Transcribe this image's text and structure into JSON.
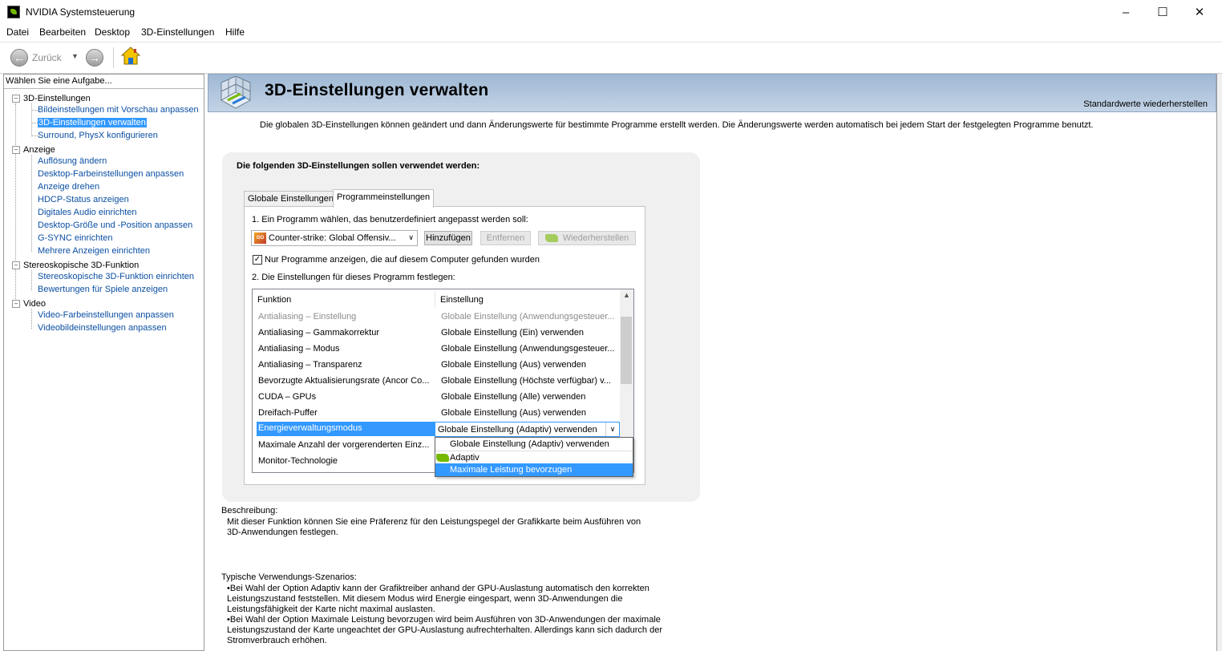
{
  "window": {
    "title": "NVIDIA Systemsteuerung"
  },
  "menu": [
    "Datei",
    "Bearbeiten",
    "Desktop",
    "3D-Einstellungen",
    "Hilfe"
  ],
  "toolbar": {
    "back_label": "Zurück"
  },
  "sidebar": {
    "header": "Wählen Sie eine Aufgabe...",
    "categories": [
      {
        "label": "3D-Einstellungen",
        "items": [
          "Bildeinstellungen mit Vorschau anpassen",
          "3D-Einstellungen verwalten",
          "Surround, PhysX konfigurieren"
        ]
      },
      {
        "label": "Anzeige",
        "items": [
          "Auflösung ändern",
          "Desktop-Farbeinstellungen anpassen",
          "Anzeige drehen",
          "HDCP-Status anzeigen",
          "Digitales Audio einrichten",
          "Desktop-Größe und -Position anpassen",
          "G-SYNC einrichten",
          "Mehrere Anzeigen einrichten"
        ]
      },
      {
        "label": "Stereoskopische 3D-Funktion",
        "items": [
          "Stereoskopische 3D-Funktion einrichten",
          "Bewertungen für Spiele anzeigen"
        ]
      },
      {
        "label": "Video",
        "items": [
          "Video-Farbeinstellungen anpassen",
          "Videobildeinstellungen anpassen"
        ]
      }
    ],
    "selected": "3D-Einstellungen verwalten"
  },
  "main": {
    "title": "3D-Einstellungen verwalten",
    "restore_defaults": "Standardwerte wiederherstellen",
    "intro": "Die globalen 3D-Einstellungen können geändert und dann Änderungswerte für bestimmte Programme erstellt werden. Die Änderungswerte werden automatisch bei jedem Start der festgelegten Programme benutzt.",
    "settings_title": "Die folgenden 3D-Einstellungen sollen verwendet werden:",
    "tabs": [
      "Globale Einstellungen",
      "Programmeinstellungen"
    ],
    "active_tab": "Programmeinstellungen",
    "step1": "1. Ein Programm wählen, das benutzerdefiniert angepasst werden soll:",
    "program_selected": "Counter-strike: Global Offensiv...",
    "program_icon_text": "GO",
    "buttons": {
      "add": "Hinzufügen",
      "remove": "Entfernen",
      "restore": "Wiederherstellen"
    },
    "show_only_label": "Nur Programme anzeigen, die auf diesem Computer gefunden wurden",
    "show_only_checked": true,
    "step2": "2. Die Einstellungen für dieses Programm festlegen:",
    "columns": [
      "Funktion",
      "Einstellung"
    ],
    "rows": [
      {
        "func": "Antialiasing – Einstellung",
        "value": "Globale Einstellung (Anwendungsgesteuer...",
        "dim": true
      },
      {
        "func": "Antialiasing – Gammakorrektur",
        "value": "Globale Einstellung (Ein) verwenden"
      },
      {
        "func": "Antialiasing – Modus",
        "value": "Globale Einstellung (Anwendungsgesteuer..."
      },
      {
        "func": "Antialiasing – Transparenz",
        "value": "Globale Einstellung (Aus) verwenden"
      },
      {
        "func": "Bevorzugte Aktualisierungsrate (Ancor Co...",
        "value": "Globale Einstellung (Höchste verfügbar) v..."
      },
      {
        "func": "CUDA – GPUs",
        "value": "Globale Einstellung (Alle) verwenden"
      },
      {
        "func": "Dreifach-Puffer",
        "value": "Globale Einstellung (Aus) verwenden"
      },
      {
        "func": "Energieverwaltungsmodus",
        "value": "Globale Einstellung (Adaptiv) verwenden",
        "selected": true
      },
      {
        "func": "Maximale Anzahl der vorgerenderten Einz...",
        "value": ""
      },
      {
        "func": "Monitor-Technologie",
        "value": ""
      }
    ],
    "dropdown_options": [
      "Globale Einstellung (Adaptiv) verwenden",
      "Adaptiv",
      "Maximale Leistung bevorzugen"
    ],
    "dropdown_highlighted": "Maximale Leistung bevorzugen",
    "description_label": "Beschreibung:",
    "description": "Mit dieser Funktion können Sie eine Präferenz für den Leistungspegel der Grafikkarte beim Ausführen von 3D-Anwendungen festlegen.",
    "usage_label": "Typische Verwendungs-Szenarios:",
    "usage": [
      "Bei Wahl der Option Adaptiv kann der Grafiktreiber anhand der GPU-Auslastung automatisch den korrekten Leistungszustand feststellen. Mit diesem Modus wird Energie eingespart, wenn 3D-Anwendungen die Leistungsfähigkeit der Karte nicht maximal auslasten.",
      "Bei Wahl der Option Maximale Leistung bevorzugen wird beim Ausführen von 3D-Anwendungen der maximale Leistungszustand der Karte ungeachtet der GPU-Auslastung aufrechterhalten. Allerdings kann sich dadurch der Stromverbrauch erhöhen."
    ]
  },
  "colors": {
    "accent": "#3399ff",
    "nvidia_green": "#76b900",
    "link": "#0b4fa3",
    "header_bg": "#b3c7de"
  }
}
